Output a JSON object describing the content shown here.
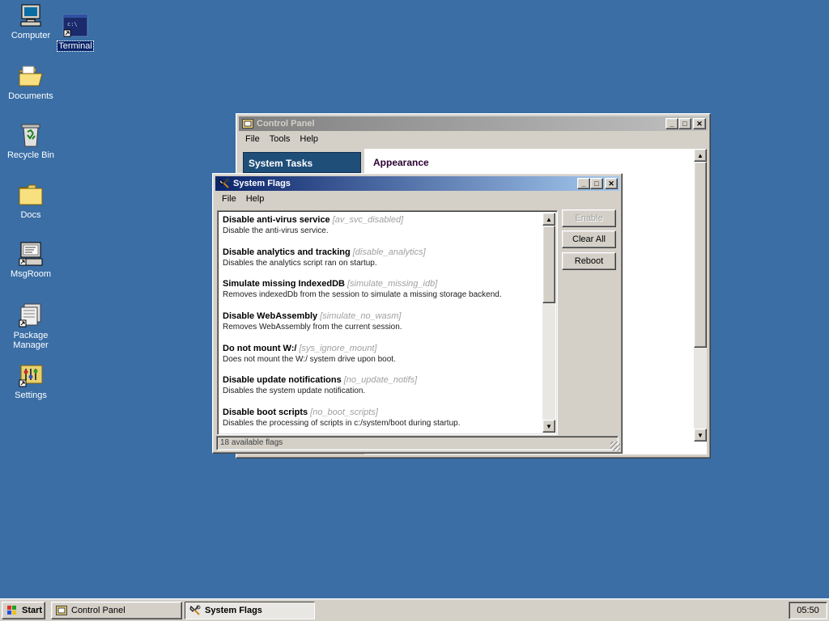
{
  "desktop": {
    "icons": [
      {
        "label": "Computer",
        "icon": "computer-icon"
      },
      {
        "label": "Terminal",
        "icon": "terminal-icon"
      },
      {
        "label": "Documents",
        "icon": "folder-open-icon"
      },
      {
        "label": "Recycle Bin",
        "icon": "recycle-bin-icon"
      },
      {
        "label": "Docs",
        "icon": "folder-icon"
      },
      {
        "label": "MsgRoom",
        "icon": "msgroom-icon"
      },
      {
        "label": "Package Manager",
        "icon": "package-icon"
      },
      {
        "label": "Settings",
        "icon": "settings-icon"
      }
    ],
    "background": "#3a6ea5"
  },
  "control_panel": {
    "title": "Control Panel",
    "menu": [
      "File",
      "Tools",
      "Help"
    ],
    "tasks_header": "System Tasks",
    "section_title": "Appearance"
  },
  "system_flags": {
    "title": "System Flags",
    "menu": [
      "File",
      "Help"
    ],
    "flags": [
      {
        "name": "Disable anti-virus service",
        "key": "[av_svc_disabled]",
        "desc": "Disable the anti-virus service."
      },
      {
        "name": "Disable analytics and tracking",
        "key": "[disable_analytics]",
        "desc": "Disables the analytics script ran on startup."
      },
      {
        "name": "Simulate missing IndexedDB",
        "key": "[simulate_missing_idb]",
        "desc": "Removes indexedDb from the session to simulate a missing storage backend."
      },
      {
        "name": "Disable WebAssembly",
        "key": "[simulate_no_wasm]",
        "desc": "Removes WebAssembly from the current session."
      },
      {
        "name": "Do not mount W:/",
        "key": "[sys_ignore_mount]",
        "desc": "Does not mount the W:/ system drive upon boot."
      },
      {
        "name": "Disable update notifications",
        "key": "[no_update_notifs]",
        "desc": "Disables the system update notification."
      },
      {
        "name": "Disable boot scripts",
        "key": "[no_boot_scripts]",
        "desc": "Disables the processing of scripts in c:/system/boot during startup."
      }
    ],
    "buttons": {
      "enable": "Enable",
      "clear_all": "Clear All",
      "reboot": "Reboot"
    },
    "status": "18 available flags"
  },
  "taskbar": {
    "start": "Start",
    "items": [
      {
        "label": "Control Panel",
        "icon": "control-panel-icon",
        "active": false
      },
      {
        "label": "System Flags",
        "icon": "system-flags-icon",
        "active": true
      }
    ],
    "clock": "05:50"
  }
}
